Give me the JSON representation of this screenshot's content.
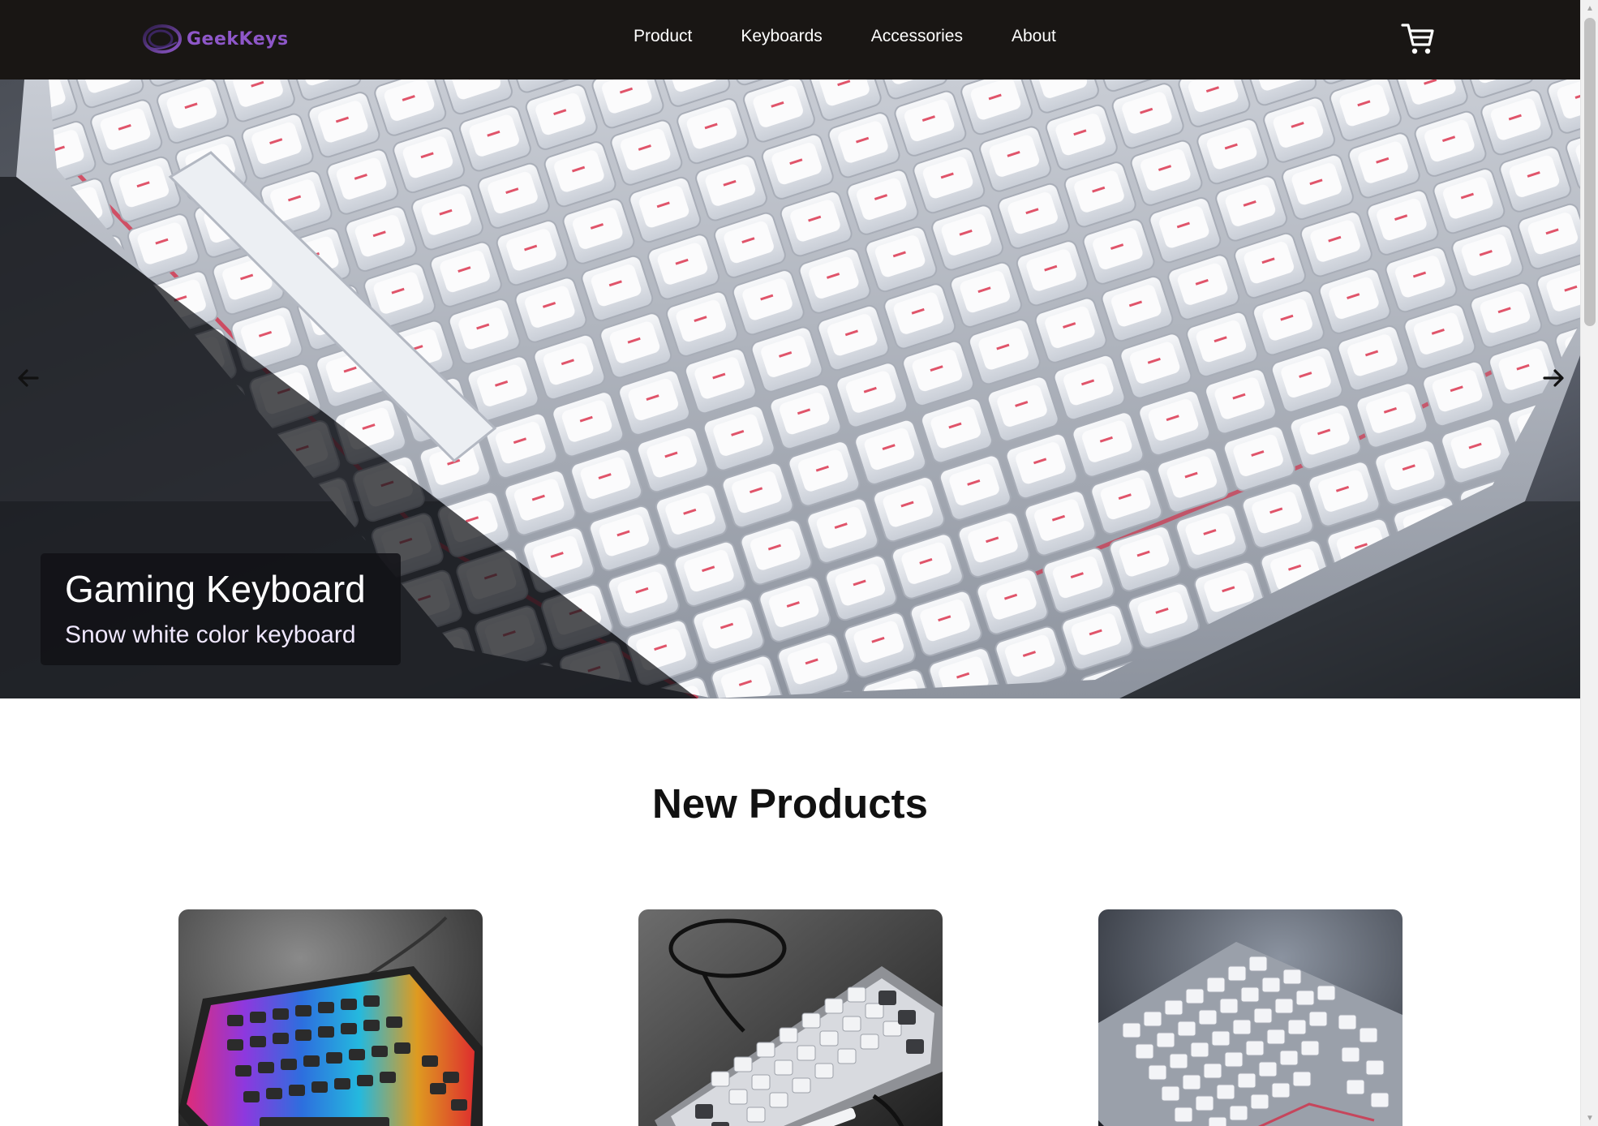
{
  "brand": {
    "name": "GeekKeys",
    "accent_color": "#8e57c9"
  },
  "nav": {
    "items": [
      {
        "label": "Product"
      },
      {
        "label": "Keyboards"
      },
      {
        "label": "Accessories"
      },
      {
        "label": "About"
      }
    ],
    "cart_icon": "shopping-cart-icon"
  },
  "hero": {
    "title": "Gaming Keyboard",
    "subtitle": "Snow white color keyboard",
    "prev_icon": "arrow-left-icon",
    "next_icon": "arrow-right-icon"
  },
  "new_products": {
    "heading": "New Products",
    "items": [
      {
        "image": "rgb-mechanical-keyboard"
      },
      {
        "image": "white-compact-keyboard-with-cable"
      },
      {
        "image": "white-tenkeyless-keyboard"
      }
    ]
  }
}
